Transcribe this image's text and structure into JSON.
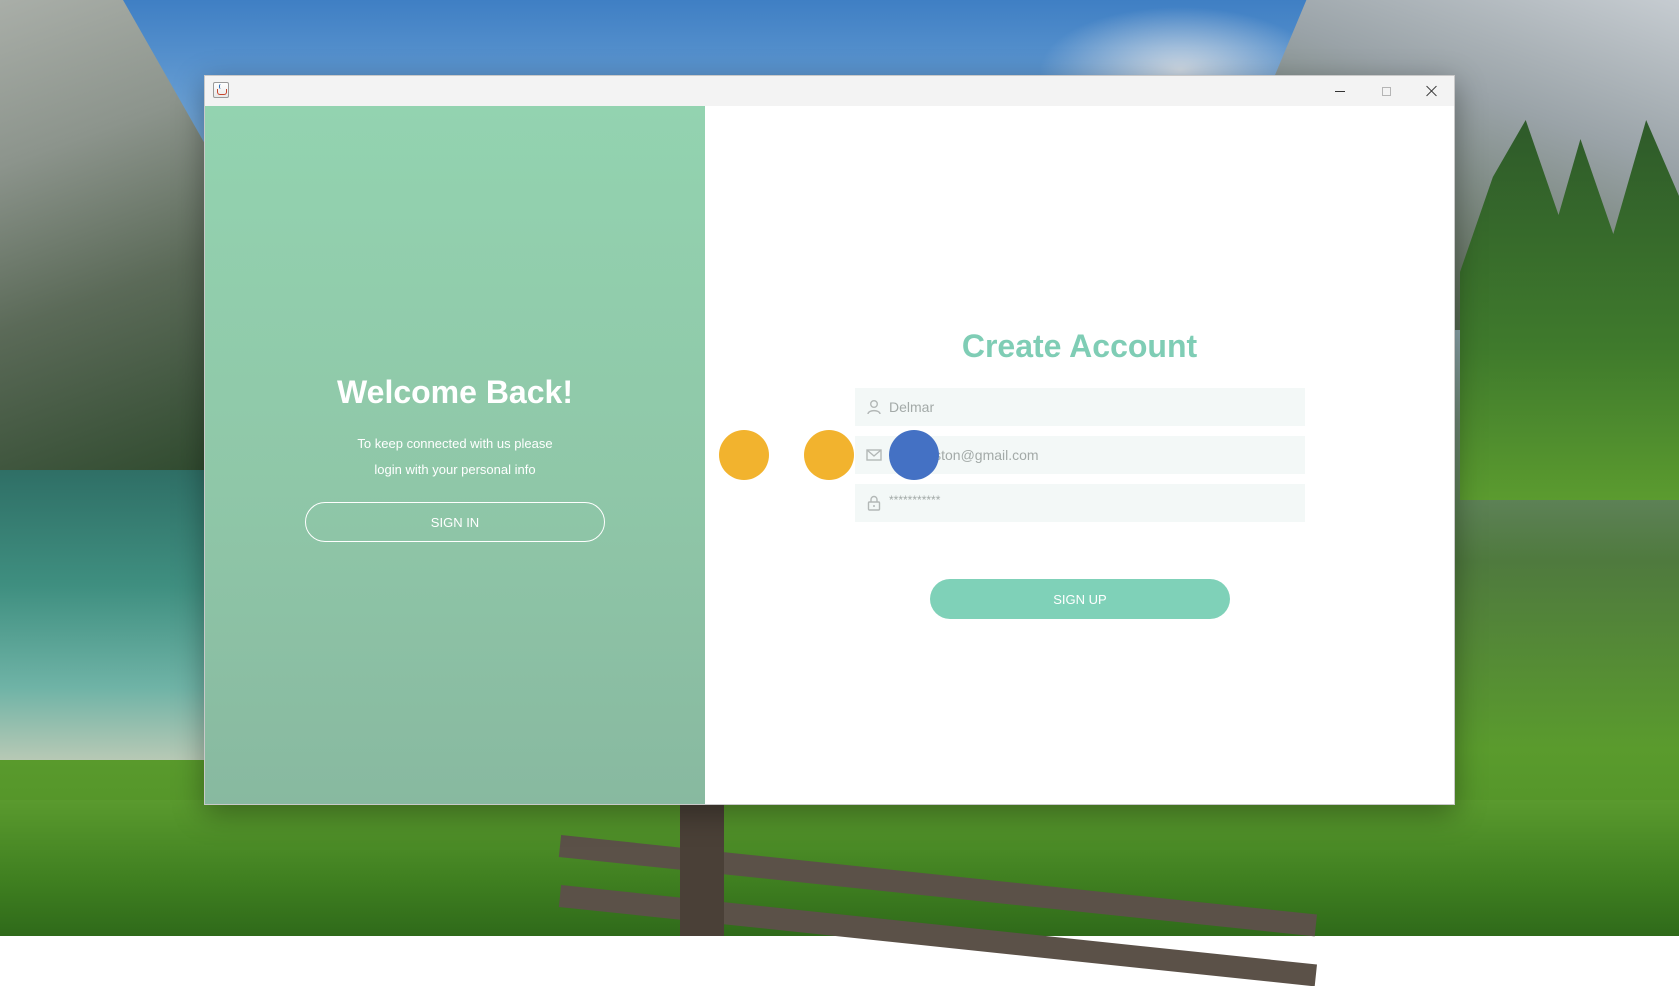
{
  "window": {
    "app_icon": "java-cup-icon",
    "controls": [
      "minimize-icon",
      "maximize-icon",
      "close-icon"
    ]
  },
  "welcome": {
    "title": "Welcome Back!",
    "line1": "To keep connected with us please",
    "line2": "login with your personal info",
    "signin_label": "SIGN IN"
  },
  "signup": {
    "title": "Create Account",
    "name_value": "Delmar",
    "email_value": "iston@gmail.com",
    "password_value": "***********",
    "signup_label": "SIGN UP",
    "icons": [
      "user-icon",
      "mail-icon",
      "lock-icon"
    ]
  },
  "colors": {
    "left_panel": "#93d3b0",
    "accent": "#7fcdb5",
    "dot_yellow": "#f2b32e",
    "dot_blue": "#4471c4"
  }
}
